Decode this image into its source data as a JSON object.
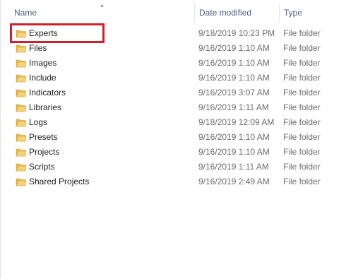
{
  "columns": {
    "name": "Name",
    "date": "Date modified",
    "type": "Type"
  },
  "sort": {
    "column": "name",
    "direction": "ascending",
    "icon": "sort-up-arrow-icon"
  },
  "icons": {
    "folder": "folder-icon"
  },
  "colors": {
    "folder_body": "#e8b84a",
    "folder_front": "#f5d27a",
    "highlight": "#d0202e",
    "header_text": "#4c607a"
  },
  "files": [
    {
      "name": "Experts",
      "date": "9/18/2019 10:23 PM",
      "type": "File folder"
    },
    {
      "name": "Files",
      "date": "9/16/2019 1:10 AM",
      "type": "File folder"
    },
    {
      "name": "Images",
      "date": "9/16/2019 1:10 AM",
      "type": "File folder"
    },
    {
      "name": "Include",
      "date": "9/16/2019 1:10 AM",
      "type": "File folder"
    },
    {
      "name": "Indicators",
      "date": "9/16/2019 3:07 AM",
      "type": "File folder"
    },
    {
      "name": "Libraries",
      "date": "9/16/2019 1:11 AM",
      "type": "File folder"
    },
    {
      "name": "Logs",
      "date": "9/18/2019 12:09 AM",
      "type": "File folder"
    },
    {
      "name": "Presets",
      "date": "9/16/2019 1:10 AM",
      "type": "File folder"
    },
    {
      "name": "Projects",
      "date": "9/16/2019 1:10 AM",
      "type": "File folder"
    },
    {
      "name": "Scripts",
      "date": "9/16/2019 1:11 AM",
      "type": "File folder"
    },
    {
      "name": "Shared Projects",
      "date": "9/16/2019 2:49 AM",
      "type": "File folder"
    }
  ]
}
